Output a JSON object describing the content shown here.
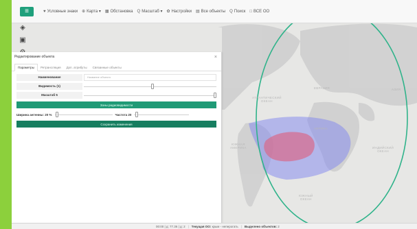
{
  "topbar": {
    "items": [
      {
        "icon": "map-marker-icon",
        "glyph": "♥",
        "label": "Условные знаки"
      },
      {
        "icon": "globe-icon",
        "glyph": "⊕",
        "label": "Карта ▾"
      },
      {
        "icon": "grid-icon",
        "glyph": "▦",
        "label": "Обстановка"
      },
      {
        "icon": "zoom-icon",
        "glyph": "Q",
        "label": "Масштаб ▾"
      },
      {
        "icon": "gear-icon",
        "glyph": "✿",
        "label": "Настройки"
      },
      {
        "icon": "list-icon",
        "glyph": "▤",
        "label": "Все объекты"
      },
      {
        "icon": "search-icon",
        "glyph": "Q",
        "label": "Поиск"
      },
      {
        "icon": "box-icon",
        "glyph": "□",
        "label": "ВСЕ ОО"
      }
    ]
  },
  "panel": {
    "title": "Редактирование объекта",
    "close": "×",
    "tabs": [
      "Параметры",
      "Ретрансляция",
      "Доп. атрибуты",
      "Связанные объекты"
    ],
    "active_tab": 0,
    "name_label": "Наименование",
    "name_placeholder": "Название объекта",
    "visibility_label": "Видимость (1)",
    "visibility_value": 0.52,
    "scale_label": "Масштаб 5",
    "scale_value": 1.0,
    "zones_button": "Зоны радиовидимости",
    "width_label": "Ширина антенны: 20 %",
    "width_value": 0.02,
    "freq_label": "Частота 20",
    "freq_value": 0.02,
    "save_button": "Сохранить изменения"
  },
  "map": {
    "labels": [
      {
        "id": "eurasia",
        "text": "ЕВРАЗИЯ"
      },
      {
        "id": "asia",
        "text": "АЗИЯ"
      },
      {
        "id": "africa",
        "text": "АФРИКА"
      },
      {
        "id": "south-america",
        "text": "ЮЖНАЯ\nАМЕРИКА"
      },
      {
        "id": "atlantic",
        "text": "АТЛАНТИЧЕСКИЙ\nОКЕАН"
      },
      {
        "id": "indian",
        "text": "ИНДИЙСКИЙ\nОКЕАН"
      },
      {
        "id": "southern",
        "text": "ЮЖНЫЙ\nОКЕАН"
      }
    ],
    "colors": {
      "land": "#cfcfcf",
      "water": "#e7e7e5",
      "zone_outer": "#7f86f0",
      "zone_inner": "#d86a8a",
      "ellipse": "#2fb38a",
      "pin": "#2a6fd6"
    }
  },
  "status": {
    "coords": "00:00 | д: 77.36 | д: 2",
    "current_label": "Текущая ОО:",
    "current_value": "крым - неперогать",
    "selected_label": "Выделено объектов:",
    "selected_value": "2"
  }
}
